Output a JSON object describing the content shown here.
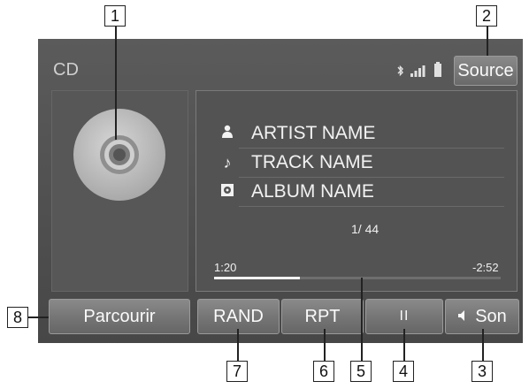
{
  "screen": {
    "mode_label": "CD",
    "status": {
      "bluetooth_icon": "bluetooth-icon",
      "signal_icon": "signal-bars-icon",
      "battery_icon": "battery-icon"
    },
    "source_label": "Source"
  },
  "now_playing": {
    "artist": "ARTIST NAME",
    "track": "TRACK NAME",
    "album": "ALBUM NAME",
    "track_position": "1/ 44",
    "elapsed": "1:20",
    "remaining": "-2:52",
    "progress": 0.3
  },
  "buttons": {
    "browse": "Parcourir",
    "random": "RAND",
    "repeat": "RPT",
    "pause": "II",
    "sound": "Son"
  },
  "callouts": {
    "c1": "1",
    "c2": "2",
    "c3": "3",
    "c4": "4",
    "c5": "5",
    "c6": "6",
    "c7": "7",
    "c8": "8"
  }
}
